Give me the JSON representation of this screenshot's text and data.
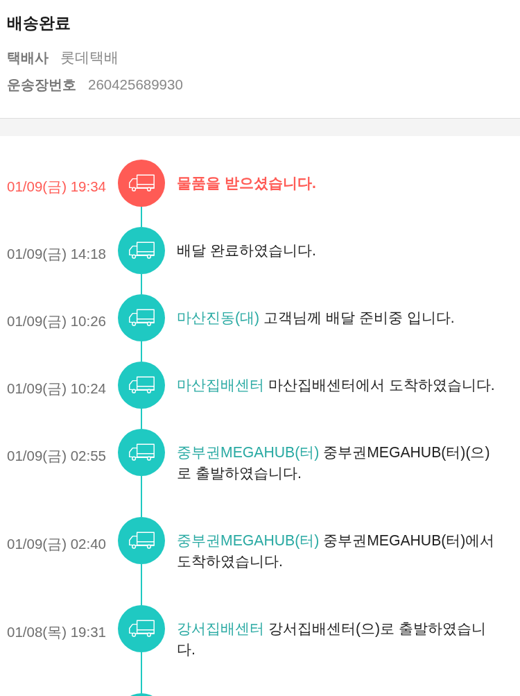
{
  "header": {
    "title": "배송완료",
    "info": [
      {
        "label": "택배사",
        "value": "롯데택배"
      },
      {
        "label": "운송장번호",
        "value": "260425689930"
      }
    ]
  },
  "timeline": [
    {
      "current": true,
      "time": "01/09(금) 19:34",
      "message": "물품을 받으셨습니다."
    },
    {
      "current": false,
      "time": "01/09(금) 14:18",
      "message": "배달 완료하였습니다."
    },
    {
      "current": false,
      "time": "01/09(금) 10:26",
      "location": "마산진동(대)",
      "message": "고객님께 배달 준비중 입니다."
    },
    {
      "current": false,
      "time": "01/09(금) 10:24",
      "location": "마산집배센터",
      "message": "마산집배센터에서 도착하였습니다."
    },
    {
      "current": false,
      "time": "01/09(금) 02:55",
      "location": "중부권MEGAHUB(터)",
      "message": "중부권MEGAHUB(터)(으)로 출발하였습니다."
    },
    {
      "current": false,
      "time": "01/09(금) 02:40",
      "location": "중부권MEGAHUB(터)",
      "message": "중부권MEGAHUB(터)에서 도착하였습니다."
    },
    {
      "current": false,
      "time": "01/08(목) 19:31",
      "location": "강서집배센터",
      "message": "강서집배센터(으)로 출발하였습니다."
    },
    {
      "current": false
    }
  ]
}
